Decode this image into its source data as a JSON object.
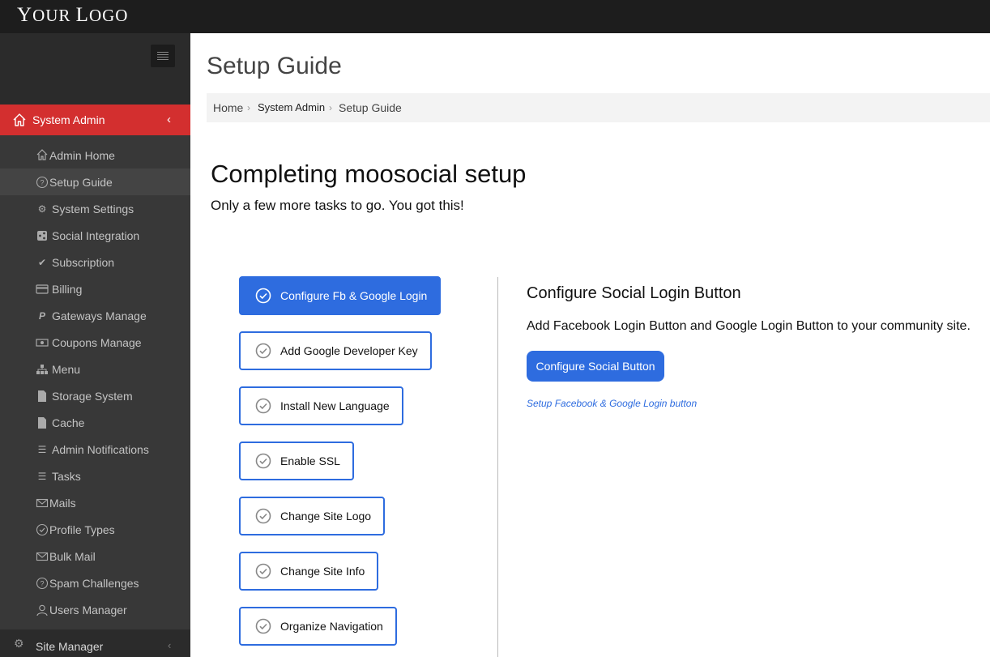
{
  "header": {
    "logo_big": "Y",
    "logo_rest": "OUR ",
    "logo_big2": "L",
    "logo_rest2": "OGO"
  },
  "sidebar": {
    "section_label": "System Admin",
    "items": [
      {
        "label": "Admin Home",
        "icon": "home-icon"
      },
      {
        "label": "Setup Guide",
        "icon": "question-circle-icon"
      },
      {
        "label": "System Settings",
        "icon": "gear-icon"
      },
      {
        "label": "Social Integration",
        "icon": "share-icon"
      },
      {
        "label": "Subscription",
        "icon": "check-icon"
      },
      {
        "label": "Billing",
        "icon": "credit-card-icon"
      },
      {
        "label": "Gateways Manage",
        "icon": "paypal-icon"
      },
      {
        "label": "Coupons Manage",
        "icon": "money-icon"
      },
      {
        "label": "Menu",
        "icon": "sitemap-icon"
      },
      {
        "label": "Storage System",
        "icon": "file-icon"
      },
      {
        "label": "Cache",
        "icon": "file-icon"
      },
      {
        "label": "Admin Notifications",
        "icon": "list-icon"
      },
      {
        "label": "Tasks",
        "icon": "list-icon"
      },
      {
        "label": "Mails",
        "icon": "envelope-icon"
      },
      {
        "label": "Profile Types",
        "icon": "check-circle-icon"
      },
      {
        "label": "Bulk Mail",
        "icon": "envelope-icon"
      },
      {
        "label": "Spam Challenges",
        "icon": "question-circle-icon"
      },
      {
        "label": "Users Manager",
        "icon": "user-icon"
      }
    ],
    "active_item": "Setup Guide",
    "site_manager_label": "Site Manager"
  },
  "main": {
    "page_title": "Setup Guide",
    "breadcrumb": [
      "Home",
      "System Admin",
      "Setup Guide"
    ],
    "heading": "Completing moosocial setup",
    "subheading": "Only a few more tasks to go. You got this!",
    "tasks": [
      "Configure Fb & Google Login",
      "Add Google Developer Key",
      "Install New Language",
      "Enable SSL",
      "Change Site Logo",
      "Change Site Info",
      "Organize Navigation"
    ],
    "active_task": "Configure Fb & Google Login",
    "detail": {
      "title": "Configure Social Login Button",
      "description": "Add Facebook Login Button and Google Login Button to your community site.",
      "button_label": "Configure Social Button",
      "link_text": "Setup Facebook & Google Login button"
    }
  },
  "colors": {
    "accent": "#2e6cdf",
    "sidebar_active": "#d32f2f",
    "sidebar_bg": "#383838",
    "topbar": "#1d1d1d"
  }
}
